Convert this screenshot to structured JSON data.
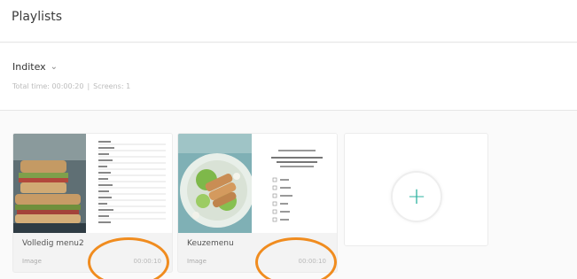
{
  "header": {
    "title": "Playlists"
  },
  "playlist": {
    "name": "Inditex",
    "chevron": "⌄",
    "total_time_label": "Total time: 00:00:20",
    "separator": "|",
    "screens_label": "Screens: 1"
  },
  "cards": [
    {
      "name": "Volledig menu2",
      "type": "Image",
      "duration": "00:00:10"
    },
    {
      "name": "Keuzemenu",
      "type": "Image",
      "duration": "00:00:10"
    }
  ],
  "add_card": {
    "icon": "+"
  },
  "colors": {
    "accent": "#2fb3a1",
    "annotation": "#f08c1f",
    "background": "#fafafa"
  }
}
